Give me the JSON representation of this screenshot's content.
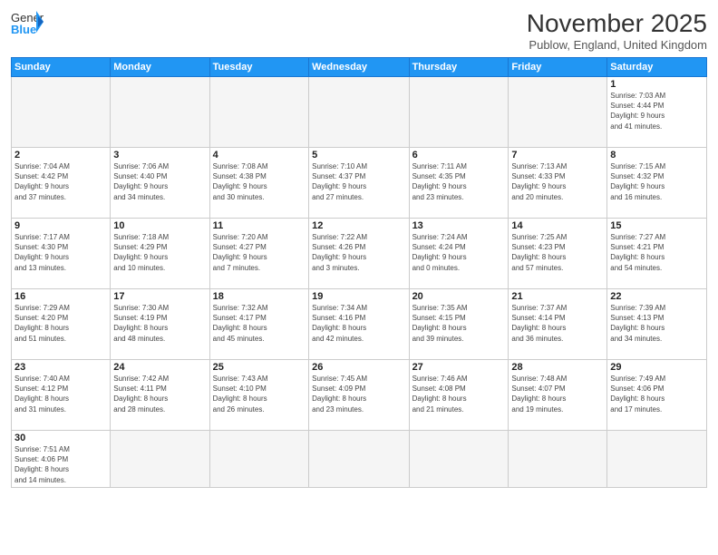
{
  "header": {
    "logo_general": "General",
    "logo_blue": "Blue",
    "month_title": "November 2025",
    "location": "Publow, England, United Kingdom"
  },
  "days_of_week": [
    "Sunday",
    "Monday",
    "Tuesday",
    "Wednesday",
    "Thursday",
    "Friday",
    "Saturday"
  ],
  "weeks": [
    [
      {
        "day": "",
        "info": ""
      },
      {
        "day": "",
        "info": ""
      },
      {
        "day": "",
        "info": ""
      },
      {
        "day": "",
        "info": ""
      },
      {
        "day": "",
        "info": ""
      },
      {
        "day": "",
        "info": ""
      },
      {
        "day": "1",
        "info": "Sunrise: 7:03 AM\nSunset: 4:44 PM\nDaylight: 9 hours\nand 41 minutes."
      }
    ],
    [
      {
        "day": "2",
        "info": "Sunrise: 7:04 AM\nSunset: 4:42 PM\nDaylight: 9 hours\nand 37 minutes."
      },
      {
        "day": "3",
        "info": "Sunrise: 7:06 AM\nSunset: 4:40 PM\nDaylight: 9 hours\nand 34 minutes."
      },
      {
        "day": "4",
        "info": "Sunrise: 7:08 AM\nSunset: 4:38 PM\nDaylight: 9 hours\nand 30 minutes."
      },
      {
        "day": "5",
        "info": "Sunrise: 7:10 AM\nSunset: 4:37 PM\nDaylight: 9 hours\nand 27 minutes."
      },
      {
        "day": "6",
        "info": "Sunrise: 7:11 AM\nSunset: 4:35 PM\nDaylight: 9 hours\nand 23 minutes."
      },
      {
        "day": "7",
        "info": "Sunrise: 7:13 AM\nSunset: 4:33 PM\nDaylight: 9 hours\nand 20 minutes."
      },
      {
        "day": "8",
        "info": "Sunrise: 7:15 AM\nSunset: 4:32 PM\nDaylight: 9 hours\nand 16 minutes."
      }
    ],
    [
      {
        "day": "9",
        "info": "Sunrise: 7:17 AM\nSunset: 4:30 PM\nDaylight: 9 hours\nand 13 minutes."
      },
      {
        "day": "10",
        "info": "Sunrise: 7:18 AM\nSunset: 4:29 PM\nDaylight: 9 hours\nand 10 minutes."
      },
      {
        "day": "11",
        "info": "Sunrise: 7:20 AM\nSunset: 4:27 PM\nDaylight: 9 hours\nand 7 minutes."
      },
      {
        "day": "12",
        "info": "Sunrise: 7:22 AM\nSunset: 4:26 PM\nDaylight: 9 hours\nand 3 minutes."
      },
      {
        "day": "13",
        "info": "Sunrise: 7:24 AM\nSunset: 4:24 PM\nDaylight: 9 hours\nand 0 minutes."
      },
      {
        "day": "14",
        "info": "Sunrise: 7:25 AM\nSunset: 4:23 PM\nDaylight: 8 hours\nand 57 minutes."
      },
      {
        "day": "15",
        "info": "Sunrise: 7:27 AM\nSunset: 4:21 PM\nDaylight: 8 hours\nand 54 minutes."
      }
    ],
    [
      {
        "day": "16",
        "info": "Sunrise: 7:29 AM\nSunset: 4:20 PM\nDaylight: 8 hours\nand 51 minutes."
      },
      {
        "day": "17",
        "info": "Sunrise: 7:30 AM\nSunset: 4:19 PM\nDaylight: 8 hours\nand 48 minutes."
      },
      {
        "day": "18",
        "info": "Sunrise: 7:32 AM\nSunset: 4:17 PM\nDaylight: 8 hours\nand 45 minutes."
      },
      {
        "day": "19",
        "info": "Sunrise: 7:34 AM\nSunset: 4:16 PM\nDaylight: 8 hours\nand 42 minutes."
      },
      {
        "day": "20",
        "info": "Sunrise: 7:35 AM\nSunset: 4:15 PM\nDaylight: 8 hours\nand 39 minutes."
      },
      {
        "day": "21",
        "info": "Sunrise: 7:37 AM\nSunset: 4:14 PM\nDaylight: 8 hours\nand 36 minutes."
      },
      {
        "day": "22",
        "info": "Sunrise: 7:39 AM\nSunset: 4:13 PM\nDaylight: 8 hours\nand 34 minutes."
      }
    ],
    [
      {
        "day": "23",
        "info": "Sunrise: 7:40 AM\nSunset: 4:12 PM\nDaylight: 8 hours\nand 31 minutes."
      },
      {
        "day": "24",
        "info": "Sunrise: 7:42 AM\nSunset: 4:11 PM\nDaylight: 8 hours\nand 28 minutes."
      },
      {
        "day": "25",
        "info": "Sunrise: 7:43 AM\nSunset: 4:10 PM\nDaylight: 8 hours\nand 26 minutes."
      },
      {
        "day": "26",
        "info": "Sunrise: 7:45 AM\nSunset: 4:09 PM\nDaylight: 8 hours\nand 23 minutes."
      },
      {
        "day": "27",
        "info": "Sunrise: 7:46 AM\nSunset: 4:08 PM\nDaylight: 8 hours\nand 21 minutes."
      },
      {
        "day": "28",
        "info": "Sunrise: 7:48 AM\nSunset: 4:07 PM\nDaylight: 8 hours\nand 19 minutes."
      },
      {
        "day": "29",
        "info": "Sunrise: 7:49 AM\nSunset: 4:06 PM\nDaylight: 8 hours\nand 17 minutes."
      }
    ],
    [
      {
        "day": "30",
        "info": "Sunrise: 7:51 AM\nSunset: 4:06 PM\nDaylight: 8 hours\nand 14 minutes."
      },
      {
        "day": "",
        "info": ""
      },
      {
        "day": "",
        "info": ""
      },
      {
        "day": "",
        "info": ""
      },
      {
        "day": "",
        "info": ""
      },
      {
        "day": "",
        "info": ""
      },
      {
        "day": "",
        "info": ""
      }
    ]
  ]
}
